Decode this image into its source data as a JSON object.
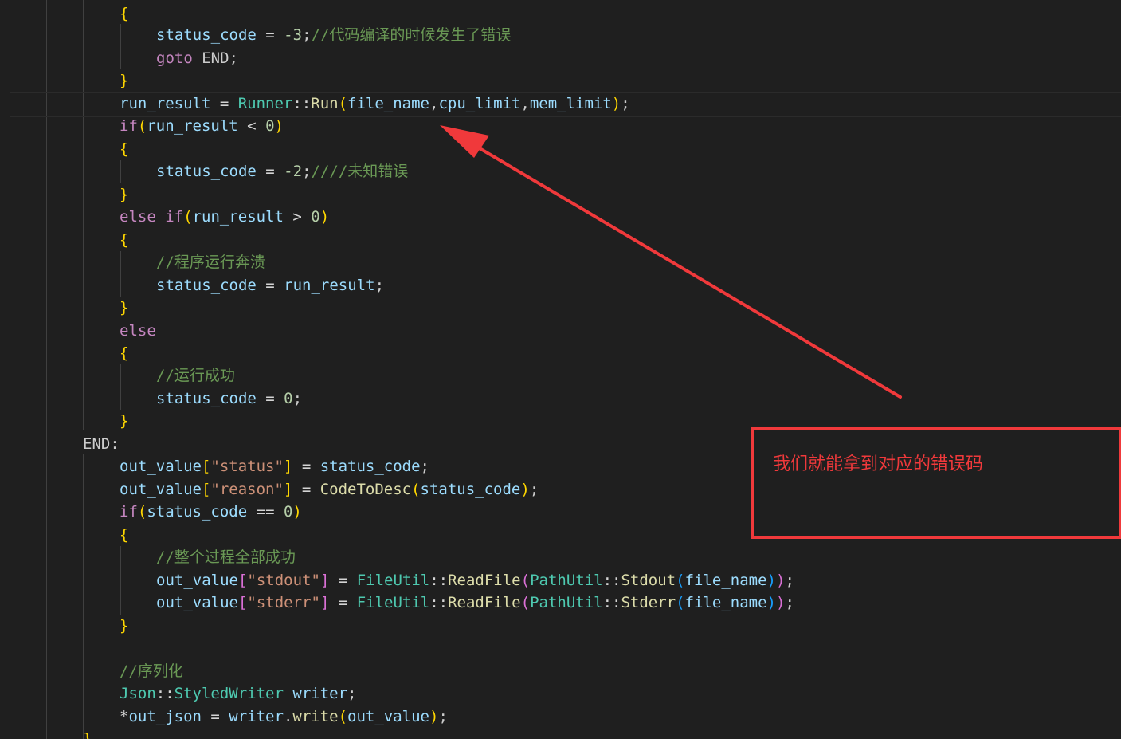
{
  "code_lines": [
    {
      "tokens": [
        {
          "t": "{",
          "c": "brace"
        }
      ]
    },
    {
      "tokens": [
        {
          "t": "status_code",
          "c": "ident"
        },
        {
          "t": " = ",
          "c": "op"
        },
        {
          "t": "-3",
          "c": "num"
        },
        {
          "t": ";",
          "c": "plain"
        },
        {
          "t": "//代码编译的时候发生了错误",
          "c": "cmt"
        }
      ]
    },
    {
      "tokens": [
        {
          "t": "goto",
          "c": "kw"
        },
        {
          "t": " END;",
          "c": "label"
        }
      ]
    },
    {
      "tokens": [
        {
          "t": "}",
          "c": "brace"
        }
      ]
    },
    {
      "tokens": [
        {
          "t": "run_result",
          "c": "ident"
        },
        {
          "t": " = ",
          "c": "op"
        },
        {
          "t": "Runner",
          "c": "type"
        },
        {
          "t": "::",
          "c": "op"
        },
        {
          "t": "Run",
          "c": "func"
        },
        {
          "t": "(",
          "c": "brace"
        },
        {
          "t": "file_name",
          "c": "ident"
        },
        {
          "t": ",",
          "c": "plain"
        },
        {
          "t": "cpu_limit",
          "c": "ident"
        },
        {
          "t": ",",
          "c": "plain"
        },
        {
          "t": "mem_limit",
          "c": "ident"
        },
        {
          "t": ")",
          "c": "brace"
        },
        {
          "t": ";",
          "c": "plain"
        }
      ]
    },
    {
      "tokens": [
        {
          "t": "if",
          "c": "kw"
        },
        {
          "t": "(",
          "c": "brace"
        },
        {
          "t": "run_result",
          "c": "ident"
        },
        {
          "t": " < ",
          "c": "op"
        },
        {
          "t": "0",
          "c": "num"
        },
        {
          "t": ")",
          "c": "brace"
        }
      ]
    },
    {
      "tokens": [
        {
          "t": "{",
          "c": "brace"
        }
      ]
    },
    {
      "tokens": [
        {
          "t": "status_code",
          "c": "ident"
        },
        {
          "t": " = ",
          "c": "op"
        },
        {
          "t": "-2",
          "c": "num"
        },
        {
          "t": ";",
          "c": "plain"
        },
        {
          "t": "////未知错误",
          "c": "cmt"
        }
      ]
    },
    {
      "tokens": [
        {
          "t": "}",
          "c": "brace"
        }
      ]
    },
    {
      "tokens": [
        {
          "t": "else",
          "c": "kw"
        },
        {
          "t": " ",
          "c": "plain"
        },
        {
          "t": "if",
          "c": "kw"
        },
        {
          "t": "(",
          "c": "brace"
        },
        {
          "t": "run_result",
          "c": "ident"
        },
        {
          "t": " > ",
          "c": "op"
        },
        {
          "t": "0",
          "c": "num"
        },
        {
          "t": ")",
          "c": "brace"
        }
      ]
    },
    {
      "tokens": [
        {
          "t": "{",
          "c": "brace"
        }
      ]
    },
    {
      "tokens": [
        {
          "t": "//程序运行奔溃",
          "c": "cmt"
        }
      ]
    },
    {
      "tokens": [
        {
          "t": "status_code",
          "c": "ident"
        },
        {
          "t": " = ",
          "c": "op"
        },
        {
          "t": "run_result",
          "c": "ident"
        },
        {
          "t": ";",
          "c": "plain"
        }
      ]
    },
    {
      "tokens": [
        {
          "t": "}",
          "c": "brace"
        }
      ]
    },
    {
      "tokens": [
        {
          "t": "else",
          "c": "kw"
        }
      ]
    },
    {
      "tokens": [
        {
          "t": "{",
          "c": "brace"
        }
      ]
    },
    {
      "tokens": [
        {
          "t": "//运行成功",
          "c": "cmt"
        }
      ]
    },
    {
      "tokens": [
        {
          "t": "status_code",
          "c": "ident"
        },
        {
          "t": " = ",
          "c": "op"
        },
        {
          "t": "0",
          "c": "num"
        },
        {
          "t": ";",
          "c": "plain"
        }
      ]
    },
    {
      "tokens": [
        {
          "t": "}",
          "c": "brace"
        }
      ]
    },
    {
      "tokens": [
        {
          "t": "END:",
          "c": "label"
        }
      ]
    },
    {
      "tokens": [
        {
          "t": "out_value",
          "c": "ident"
        },
        {
          "t": "[",
          "c": "brace"
        },
        {
          "t": "\"status\"",
          "c": "str"
        },
        {
          "t": "]",
          "c": "brace"
        },
        {
          "t": " = ",
          "c": "op"
        },
        {
          "t": "status_code",
          "c": "ident"
        },
        {
          "t": ";",
          "c": "plain"
        }
      ]
    },
    {
      "tokens": [
        {
          "t": "out_value",
          "c": "ident"
        },
        {
          "t": "[",
          "c": "brace"
        },
        {
          "t": "\"reason\"",
          "c": "str"
        },
        {
          "t": "]",
          "c": "brace"
        },
        {
          "t": " = ",
          "c": "op"
        },
        {
          "t": "CodeToDesc",
          "c": "func"
        },
        {
          "t": "(",
          "c": "brace"
        },
        {
          "t": "status_code",
          "c": "ident"
        },
        {
          "t": ")",
          "c": "brace"
        },
        {
          "t": ";",
          "c": "plain"
        }
      ]
    },
    {
      "tokens": [
        {
          "t": "if",
          "c": "kw"
        },
        {
          "t": "(",
          "c": "brace"
        },
        {
          "t": "status_code",
          "c": "ident"
        },
        {
          "t": " == ",
          "c": "op"
        },
        {
          "t": "0",
          "c": "num"
        },
        {
          "t": ")",
          "c": "brace"
        }
      ]
    },
    {
      "tokens": [
        {
          "t": "{",
          "c": "brace"
        }
      ]
    },
    {
      "tokens": [
        {
          "t": "//整个过程全部成功",
          "c": "cmt"
        }
      ]
    },
    {
      "tokens": [
        {
          "t": "out_value",
          "c": "ident"
        },
        {
          "t": "[",
          "c": "paren2"
        },
        {
          "t": "\"stdout\"",
          "c": "str"
        },
        {
          "t": "]",
          "c": "paren2"
        },
        {
          "t": " = ",
          "c": "op"
        },
        {
          "t": "FileUtil",
          "c": "type"
        },
        {
          "t": "::",
          "c": "op"
        },
        {
          "t": "ReadFile",
          "c": "func"
        },
        {
          "t": "(",
          "c": "paren2"
        },
        {
          "t": "PathUtil",
          "c": "type"
        },
        {
          "t": "::",
          "c": "op"
        },
        {
          "t": "Stdout",
          "c": "func"
        },
        {
          "t": "(",
          "c": "paren3"
        },
        {
          "t": "file_name",
          "c": "ident"
        },
        {
          "t": ")",
          "c": "paren3"
        },
        {
          "t": ")",
          "c": "paren2"
        },
        {
          "t": ";",
          "c": "plain"
        }
      ]
    },
    {
      "tokens": [
        {
          "t": "out_value",
          "c": "ident"
        },
        {
          "t": "[",
          "c": "paren2"
        },
        {
          "t": "\"stderr\"",
          "c": "str"
        },
        {
          "t": "]",
          "c": "paren2"
        },
        {
          "t": " = ",
          "c": "op"
        },
        {
          "t": "FileUtil",
          "c": "type"
        },
        {
          "t": "::",
          "c": "op"
        },
        {
          "t": "ReadFile",
          "c": "func"
        },
        {
          "t": "(",
          "c": "paren2"
        },
        {
          "t": "PathUtil",
          "c": "type"
        },
        {
          "t": "::",
          "c": "op"
        },
        {
          "t": "Stderr",
          "c": "func"
        },
        {
          "t": "(",
          "c": "paren3"
        },
        {
          "t": "file_name",
          "c": "ident"
        },
        {
          "t": ")",
          "c": "paren3"
        },
        {
          "t": ")",
          "c": "paren2"
        },
        {
          "t": ";",
          "c": "plain"
        }
      ]
    },
    {
      "tokens": [
        {
          "t": "}",
          "c": "brace"
        }
      ]
    },
    {
      "tokens": []
    },
    {
      "tokens": [
        {
          "t": "//序列化",
          "c": "cmt"
        }
      ]
    },
    {
      "tokens": [
        {
          "t": "Json",
          "c": "type"
        },
        {
          "t": "::",
          "c": "op"
        },
        {
          "t": "StyledWriter",
          "c": "type"
        },
        {
          "t": " ",
          "c": "plain"
        },
        {
          "t": "writer",
          "c": "ident"
        },
        {
          "t": ";",
          "c": "plain"
        }
      ]
    },
    {
      "tokens": [
        {
          "t": "*",
          "c": "op"
        },
        {
          "t": "out_json",
          "c": "ident"
        },
        {
          "t": " = ",
          "c": "op"
        },
        {
          "t": "writer",
          "c": "ident"
        },
        {
          "t": ".",
          "c": "plain"
        },
        {
          "t": "write",
          "c": "func"
        },
        {
          "t": "(",
          "c": "brace"
        },
        {
          "t": "out_value",
          "c": "ident"
        },
        {
          "t": ")",
          "c": "brace"
        },
        {
          "t": ";",
          "c": "plain"
        }
      ]
    },
    {
      "tokens": [
        {
          "t": "}",
          "c": "brace"
        }
      ]
    }
  ],
  "annotation": {
    "text": "我们就能拿到对应的错误码",
    "color": "#f0393b"
  },
  "colors": {
    "background": "#1f1f1f",
    "keyword": "#c586c0",
    "identifier": "#9cdcfe",
    "type": "#4ec9b0",
    "function": "#dcdcaa",
    "number": "#b5cea8",
    "string": "#ce9178",
    "comment": "#6a9955",
    "bracket_level1": "#ffd700",
    "bracket_level2": "#da70d6",
    "bracket_level3": "#179fff"
  }
}
